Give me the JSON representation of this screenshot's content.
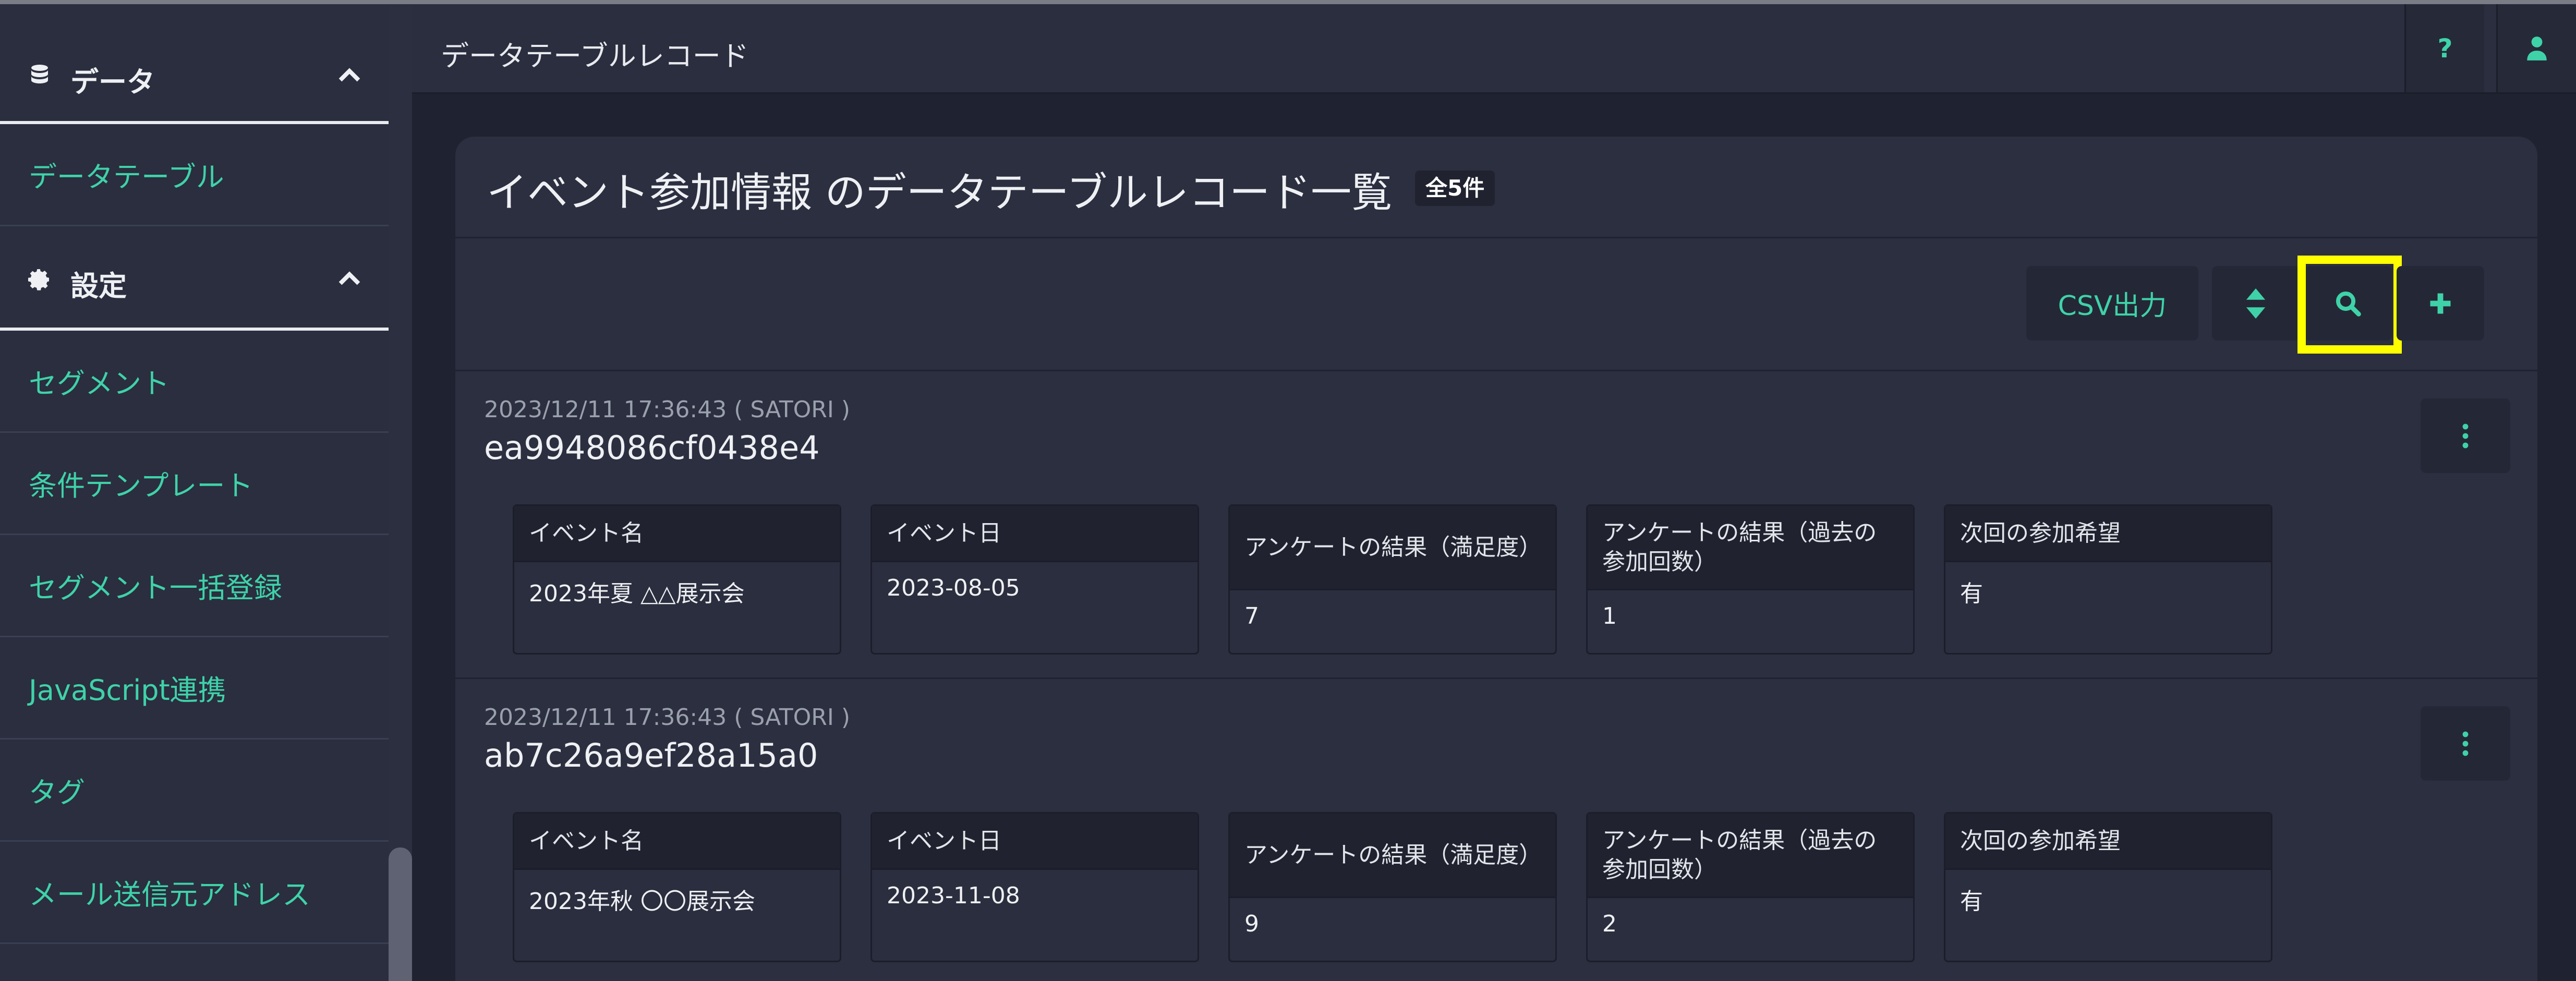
{
  "sidebar": {
    "data_section": "データ",
    "data_items": [
      "データテーブル"
    ],
    "settings_section": "設定",
    "settings_items": [
      "セグメント",
      "条件テンプレート",
      "セグメント一括登録",
      "JavaScript連携",
      "タグ",
      "メール送信元アドレス"
    ]
  },
  "topbar": {
    "title": "データテーブルレコード",
    "help_label": "?"
  },
  "card": {
    "title": "イベント参加情報 のデータテーブルレコード一覧",
    "count_badge": "全5件"
  },
  "toolbar": {
    "csv_label": "CSV出力"
  },
  "records": [
    {
      "meta": "2023/12/11 17:36:43 ( SATORI )",
      "id": "ea9948086cf0438e4",
      "fields": [
        {
          "label": "イベント名",
          "value": "2023年夏 △△展示会"
        },
        {
          "label": "イベント日",
          "value": "2023-08-05"
        },
        {
          "label": "アンケートの結果（満足度）",
          "value": "7"
        },
        {
          "label": "アンケートの結果（過去の参加回数）",
          "value": "1"
        },
        {
          "label": "次回の参加希望",
          "value": "有"
        }
      ]
    },
    {
      "meta": "2023/12/11 17:36:43 ( SATORI )",
      "id": "ab7c26a9ef28a15a0",
      "fields": [
        {
          "label": "イベント名",
          "value": "2023年秋 〇〇展示会"
        },
        {
          "label": "イベント日",
          "value": "2023-11-08"
        },
        {
          "label": "アンケートの結果（満足度）",
          "value": "9"
        },
        {
          "label": "アンケートの結果（過去の参加回数）",
          "value": "2"
        },
        {
          "label": "次回の参加希望",
          "value": "有"
        }
      ]
    }
  ],
  "colors": {
    "accent": "#3fd2a8",
    "highlight": "#ffff00",
    "background": "#1f2230",
    "sidebar": "#2a2e3f"
  }
}
